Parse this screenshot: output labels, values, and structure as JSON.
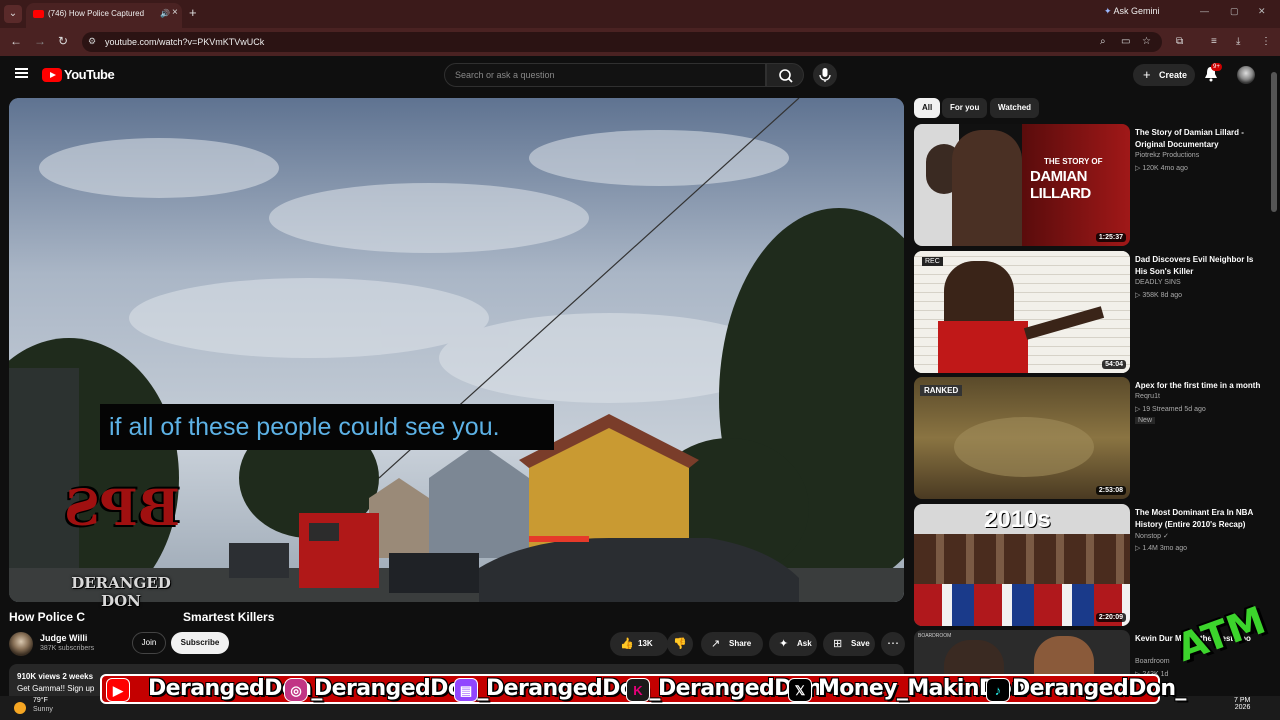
{
  "browser": {
    "tab_title": "(746) How Police Captured",
    "url": "youtube.com/watch?v=PKVmKTVwUCk",
    "gemini_label": "Ask Gemini"
  },
  "header": {
    "logo": "YouTube",
    "search_placeholder": "Search or ask a question",
    "create_label": "Create",
    "notif_badge": "9+"
  },
  "video": {
    "caption": "if all of these people could see you.",
    "title_visible_left": "How Police C",
    "title_visible_right": "Smartest Killers",
    "channel_name": "Judge Willi",
    "subscribers": "387K subscribers",
    "join_label": "Join",
    "subscribe_label": "Subscribe",
    "like_count": "13K",
    "share_label": "Share",
    "ask_label": "Ask",
    "save_label": "Save",
    "views_meta": "910K views  2 weeks",
    "desc_line": "Get Gamma!! Sign up"
  },
  "chips": [
    "All",
    "For you",
    "Watched"
  ],
  "recommendations": [
    {
      "title": "The Story of Damian Lillard - Original Documentary",
      "channel": "Piotrekz Productions",
      "meta": "▷ 120K  4mo ago",
      "duration": "1:25:37",
      "thumb_text": "THE STORY OF",
      "thumb_big": "DAMIAN LILLARD"
    },
    {
      "title": "Dad Discovers Evil Neighbor Is His Son's Killer",
      "channel": "DEADLY SINS",
      "meta": "▷ 358K  8d ago",
      "duration": "54:04",
      "thumb_text": "REC"
    },
    {
      "title": "Apex for the first time in a month",
      "channel": "Reqru1t",
      "meta": "▷ 19  Streamed 5d ago",
      "new_badge": "New",
      "duration": "2:53:08",
      "thumb_text": "RANKED"
    },
    {
      "title": "The Most Dominant Era In NBA History (Entire 2010's Recap)",
      "channel": "Nonstop ✓",
      "meta": "▷ 1.4M  3mo ago",
      "duration": "2:20:09",
      "thumb_big": "2010s"
    },
    {
      "title": "Kevin Dur Move, the Westbroo",
      "channel": "Boardroom",
      "meta": "▷ 243K  1d",
      "thumb_text": "BOARDROOM"
    }
  ],
  "overlay": {
    "logo_text": "BPS",
    "watermark_text": "DERANGED DON",
    "atm_text": "ATM",
    "handles": [
      "DerangedDon_",
      "DerangedDon_",
      "DerangedDon_",
      "DerangedDon",
      "Money_MakinDon",
      "DerangedDon_"
    ]
  },
  "taskbar": {
    "temp": "79°F",
    "weather": "Sunny",
    "time": "7 PM",
    "year": "2026"
  }
}
